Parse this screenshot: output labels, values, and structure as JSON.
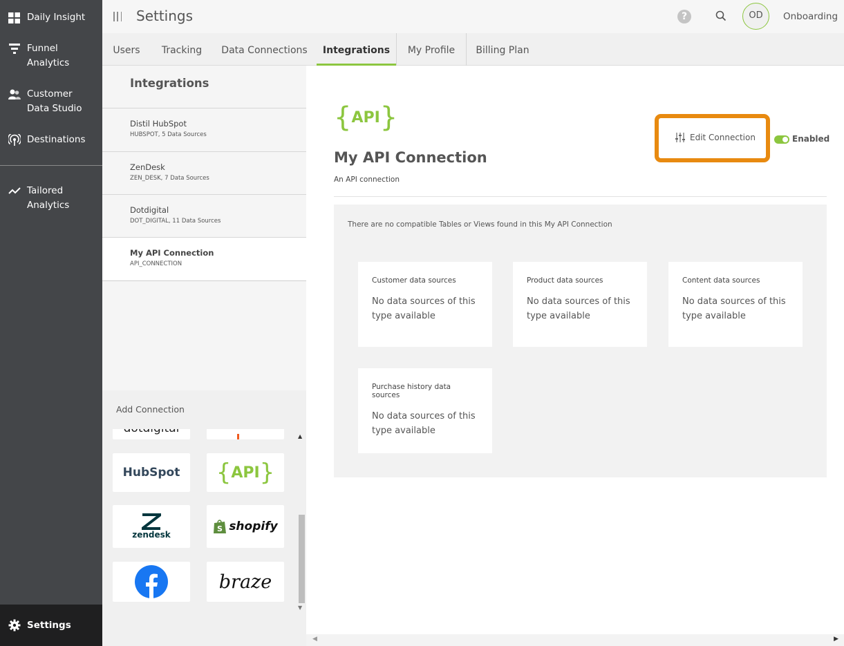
{
  "nav": {
    "items": [
      {
        "label_1": "Daily Insight",
        "label_2": "",
        "icon": "grid-icon"
      },
      {
        "label_1": "Funnel",
        "label_2": "Analytics",
        "icon": "funnel-icon"
      },
      {
        "label_1": "Customer",
        "label_2": "Data Studio",
        "icon": "users-icon"
      },
      {
        "label_1": "Destinations",
        "label_2": "",
        "icon": "broadcast-icon"
      },
      {
        "label_1": "Tailored",
        "label_2": "Analytics",
        "icon": "trend-icon"
      }
    ],
    "settings_label": "Settings"
  },
  "header": {
    "title": "Settings",
    "help_glyph": "?",
    "avatar_initials": "OD",
    "user_name": "Onboarding"
  },
  "tabs": [
    "Users",
    "Tracking",
    "Data Connections",
    "Integrations",
    "My Profile",
    "Billing Plan"
  ],
  "active_tab": "Integrations",
  "integrations": {
    "title": "Integrations",
    "items": [
      {
        "name": "Distil HubSpot",
        "sub": "HUBSPOT, 5 Data Sources"
      },
      {
        "name": "ZenDesk",
        "sub": "ZEN_DESK, 7 Data Sources"
      },
      {
        "name": "Dotdigital",
        "sub": "DOT_DIGITAL, 11 Data Sources"
      },
      {
        "name": "My API Connection",
        "sub": "API_CONNECTION"
      }
    ],
    "selected": "My API Connection"
  },
  "add_connection": {
    "title": "Add Connection",
    "logos": {
      "dotdigital": "dotdigital",
      "hubspot": "HubSpot",
      "api": "API",
      "zendesk": "zendesk",
      "shopify": "shopify",
      "braze": "braze"
    }
  },
  "connection": {
    "logo_text": "API",
    "title": "My API Connection",
    "description": "An API connection",
    "edit_label": "Edit Connection",
    "enabled_label": "Enabled",
    "enabled": true,
    "highlight_color": "#e88a10",
    "no_tables_message": "There are no compatible Tables or Views found in this My API Connection",
    "data_sources": [
      {
        "heading": "Customer data sources",
        "line_1": "No data sources of this",
        "line_2": "type available"
      },
      {
        "heading": "Product data sources",
        "line_1": "No data sources of this",
        "line_2": "type available"
      },
      {
        "heading": "Content data sources",
        "line_1": "No data sources of this",
        "line_2": "type available"
      },
      {
        "heading": "Purchase history data sources",
        "line_1": "No data sources of this",
        "line_2": "type available"
      }
    ]
  },
  "colors": {
    "accent": "#8cc63f",
    "nav_bg": "#444649",
    "nav_active_bg": "#1f1f20"
  }
}
